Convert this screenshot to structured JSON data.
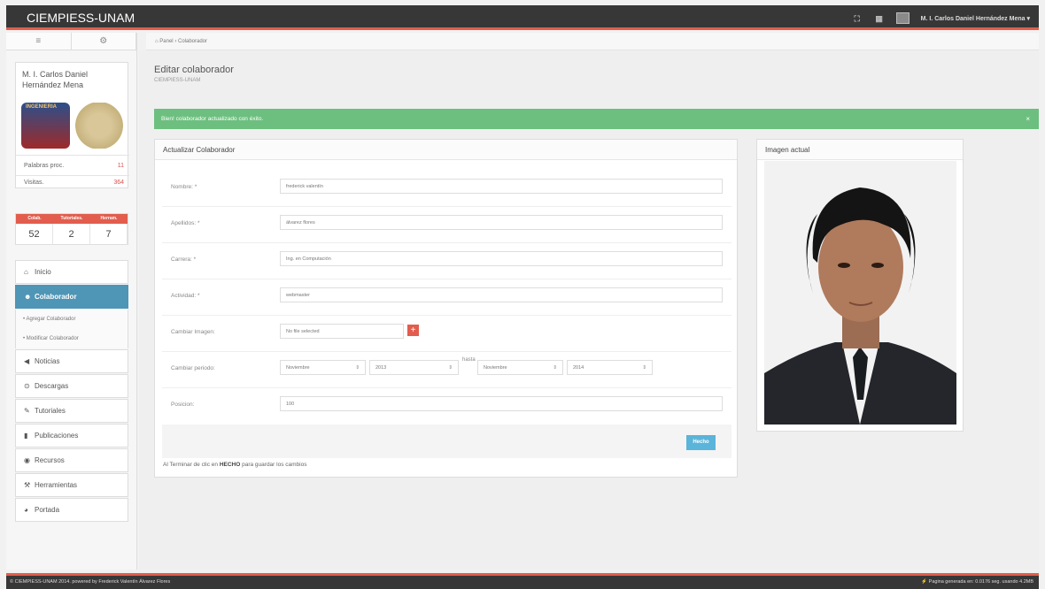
{
  "app": {
    "brand": "CIEMPIESS-UNAM"
  },
  "topbar": {
    "user_name": "M. I. Carlos Daniel Hernández Mena",
    "user_caret": "▾",
    "icons": [
      "fullscreen-icon",
      "grid-icon"
    ]
  },
  "sidebar": {
    "user_name": "M. I. Carlos Daniel Hernández Mena",
    "logo_text": "INGENIERIA",
    "stats": [
      {
        "label": "Palabras proc.",
        "value": "11"
      },
      {
        "label": "Visitas.",
        "value": "364"
      }
    ],
    "counts": {
      "headers": [
        "Colab.",
        "Tutoriales.",
        "Herram."
      ],
      "values": [
        "52",
        "2",
        "7"
      ]
    },
    "nav": [
      {
        "label": "Inicio",
        "icon": "home-icon"
      },
      {
        "label": "Colaborador",
        "icon": "users-icon",
        "active": true
      },
      {
        "label": "Noticias",
        "icon": "bullhorn-icon"
      },
      {
        "label": "Descargas",
        "icon": "download-icon"
      },
      {
        "label": "Tutoriales",
        "icon": "pencil-icon"
      },
      {
        "label": "Publicaciones",
        "icon": "book-icon"
      },
      {
        "label": "Recursos",
        "icon": "globe-icon"
      },
      {
        "label": "Herramientas",
        "icon": "wrench-icon"
      },
      {
        "label": "Portada",
        "icon": "eye-icon"
      }
    ],
    "subnav": [
      "Agregar Colaborador",
      "Modificar Colaborador"
    ]
  },
  "breadcrumb": {
    "home": "Panel",
    "separator": "›",
    "current": "Colaborador"
  },
  "page": {
    "title": "Editar colaborador",
    "subtitle": "CIEMPIESS-UNAM"
  },
  "alert": {
    "message": "Bien! colaborador actualizado con éxito.",
    "close": "×",
    "color": "#6dbf7f"
  },
  "form": {
    "title": "Actualizar Colaborador",
    "fields": [
      {
        "label": "Nombre: *",
        "value": "frederick valentín"
      },
      {
        "label": "Apellidos: *",
        "value": "álvarez flores"
      },
      {
        "label": "Carrera: *",
        "value": "Ing. en Computación"
      },
      {
        "label": "Actividad: *",
        "value": "webmaster"
      }
    ],
    "image": {
      "label": "Cambiar Imagen:",
      "value": "No file selected",
      "button": "+"
    },
    "period": {
      "label": "Cambiar periodo:",
      "from_month": "Noviembre",
      "from_year": "2013",
      "separator": "hasta",
      "to_month": "Noviembre",
      "to_year": "2014"
    },
    "position": {
      "label": "Posicion:",
      "value": "100"
    },
    "submit": "Hecho",
    "footnote_pre": "Al Terminar de clic en ",
    "footnote_bold": "HECHO",
    "footnote_post": " para guardar los cambios"
  },
  "image_panel": {
    "title": "Imagen actual"
  },
  "footer": {
    "left": "© CIEMPIESS-UNAM 2014. powered by Frederick Valentín Álvarez Flores",
    "right": "Pagina generada en: 0.0176 seg. usando 4.2MB"
  },
  "colors": {
    "accent": "#e25d4d",
    "active_nav": "#4f95b5",
    "button": "#5bb4d9"
  }
}
